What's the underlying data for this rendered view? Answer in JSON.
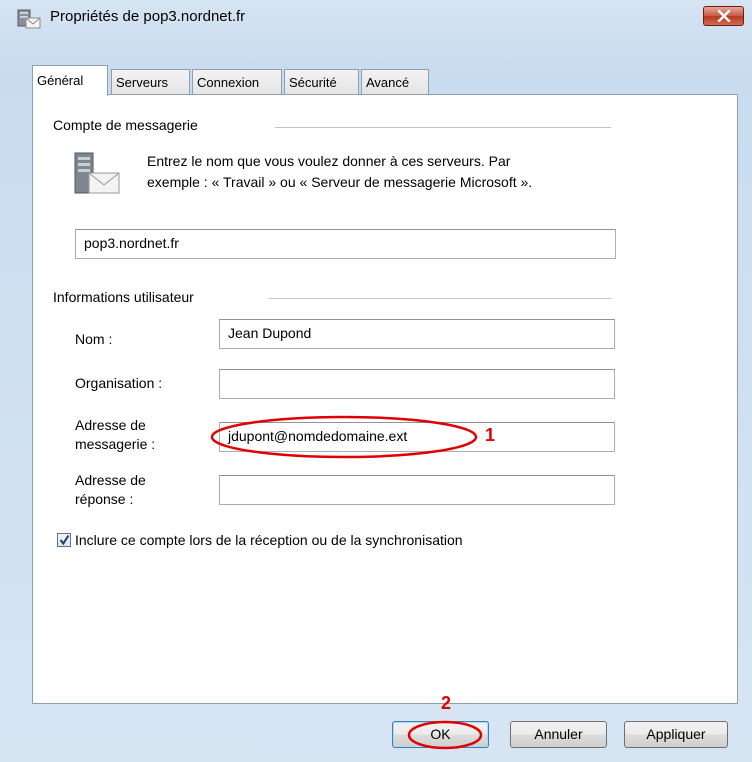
{
  "window": {
    "title": "Propriétés de pop3.nordnet.fr"
  },
  "tabs": [
    {
      "label": "Général",
      "active": true
    },
    {
      "label": "Serveurs"
    },
    {
      "label": "Connexion"
    },
    {
      "label": "Sécurité"
    },
    {
      "label": "Avancé"
    }
  ],
  "account": {
    "group_label": "Compte de messagerie",
    "description_line1": "Entrez le nom que vous voulez donner à ces serveurs. Par",
    "description_line2": "exemple : « Travail » ou « Serveur de messagerie Microsoft ».",
    "name_value": "pop3.nordnet.fr"
  },
  "user_info": {
    "group_label": "Informations utilisateur",
    "name_label": "Nom :",
    "name_value": "Jean Dupond",
    "org_label": "Organisation :",
    "org_value": "",
    "email_label_line1": "Adresse de",
    "email_label_line2": "messagerie :",
    "email_value": "jdupont@nomdedomaine.ext",
    "reply_label_line1": "Adresse de",
    "reply_label_line2": "réponse :",
    "reply_value": ""
  },
  "include_checkbox": {
    "label": "Inclure ce compte lors de la réception ou de la synchronisation",
    "checked": true
  },
  "buttons": {
    "ok": "OK",
    "cancel": "Annuler",
    "apply": "Appliquer"
  },
  "annotations": {
    "email_marker": "1",
    "ok_marker": "2",
    "color": "#e00000"
  },
  "colors": {
    "accent": "#3c7fb1",
    "close_button": "#c75944"
  }
}
